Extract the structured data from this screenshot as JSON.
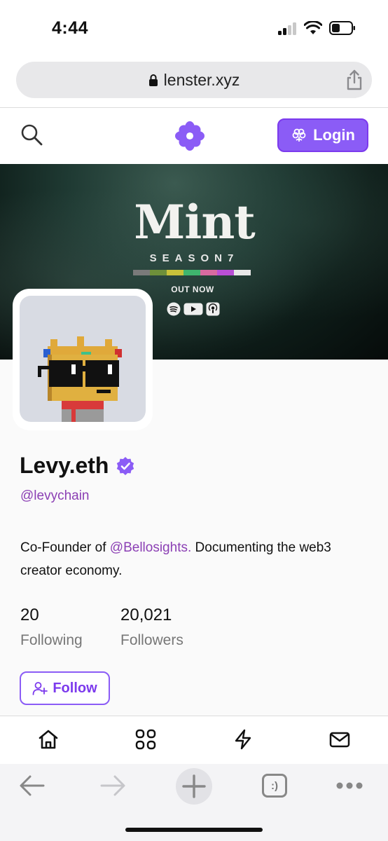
{
  "status_bar": {
    "time": "4:44"
  },
  "browser": {
    "url": "lenster.xyz"
  },
  "header": {
    "login_label": "Login"
  },
  "cover": {
    "title": "Mint",
    "subtitle": "SEASON7",
    "tagline": "OUT NOW",
    "bar_colors": [
      "#7a7a7a",
      "#6e8f3a",
      "#c9c23a",
      "#3fb56e",
      "#d86aa0",
      "#b94fd6",
      "#e8e8e8"
    ]
  },
  "profile": {
    "display_name": "Levy.eth",
    "handle": "@levychain",
    "bio_prefix": "Co-Founder of ",
    "bio_mention": "@Bellosights.",
    "bio_suffix": " Documenting the web3 creator economy.",
    "following_count": "20",
    "following_label": "Following",
    "followers_count": "20,021",
    "followers_label": "Followers",
    "follow_label": "Follow"
  },
  "bottom_nav": {
    "items": [
      "home-icon",
      "grid-icon",
      "lightning-icon",
      "mail-icon"
    ]
  },
  "browser_toolbar": {
    "tabs_glyph": ":)"
  },
  "colors": {
    "accent": "#8b5cf6",
    "mention": "#8b3fb4"
  }
}
